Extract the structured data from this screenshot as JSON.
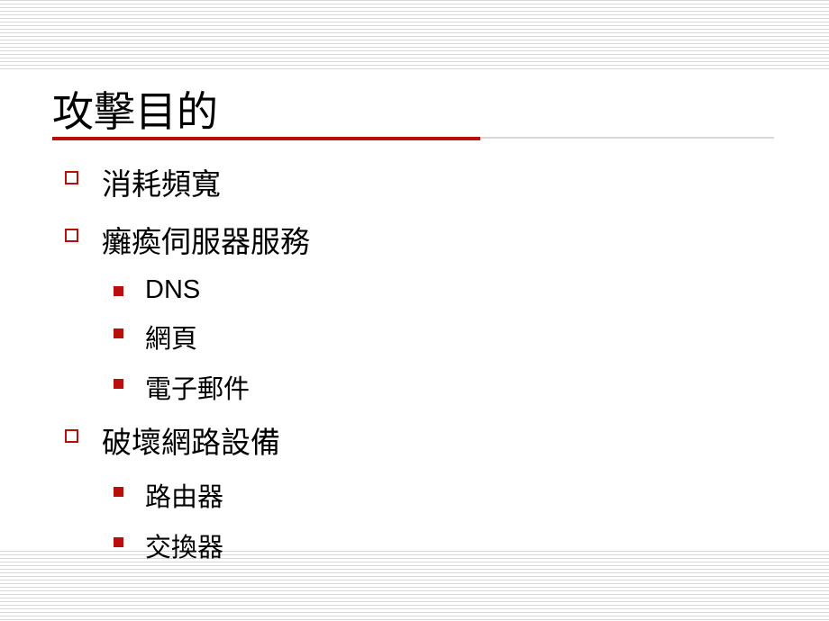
{
  "title": "攻擊目的",
  "items": [
    {
      "text": "消耗頻寬"
    },
    {
      "text": "癱瘓伺服器服務",
      "children": [
        {
          "text": "DNS"
        },
        {
          "text": "網頁"
        },
        {
          "text": "電子郵件"
        }
      ]
    },
    {
      "text": "破壞網路設備",
      "children": [
        {
          "text": "路由器"
        },
        {
          "text": "交換器"
        }
      ]
    }
  ],
  "colors": {
    "accent": "#b70f0a",
    "stripe": "#d8d8d8"
  }
}
